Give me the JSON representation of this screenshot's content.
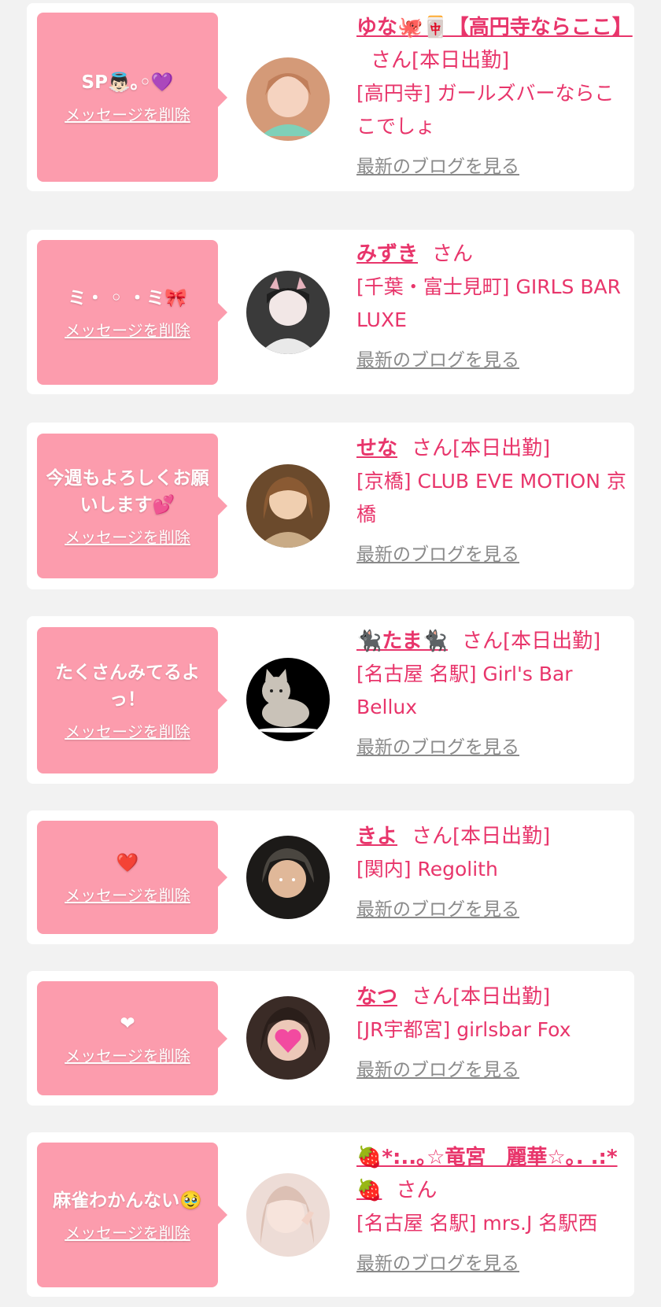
{
  "cards": [
    {
      "message": "SP👼🏻｡◦💜",
      "delete_label": "メッセージを削除",
      "name": "ゆな🐙🀄【高円寺ならここ】",
      "suffix": "さん[本日出勤]",
      "shop": "[高円寺] ガールズバーならここでしょ",
      "blog_label": "最新のブログを見る",
      "avatar_colors": [
        "#f2c7a8",
        "#d8a07a",
        "#7fd0b8"
      ]
    },
    {
      "message": "ミ・ ◦ ・ミ🎀",
      "delete_label": "メッセージを削除",
      "name": "みずき",
      "suffix": "さん",
      "shop": "[千葉・富士見町] GIRLS BAR LUXE",
      "blog_label": "最新のブログを見る",
      "avatar_colors": [
        "#2e2e2e",
        "#efe6e6",
        "#b5b5b5"
      ]
    },
    {
      "message": "今週もよろしくお願いします💕",
      "delete_label": "メッセージを削除",
      "name": "せな",
      "suffix": "さん[本日出勤]",
      "shop": "[京橋] CLUB EVE MOTION 京橋",
      "blog_label": "最新のブログを見る",
      "avatar_colors": [
        "#6b4a2c",
        "#e2c09a",
        "#c7a97f"
      ]
    },
    {
      "message": "たくさんみてるよっ！",
      "delete_label": "メッセージを削除",
      "name": "🐈‍⬛たま🐈‍⬛",
      "suffix": "さん[本日出勤]",
      "shop": "[名古屋 名駅] Girl's Bar Bellux",
      "blog_label": "最新のブログを見る",
      "avatar_colors": [
        "#000000",
        "#c9c2b8",
        "#9c9489"
      ]
    },
    {
      "message": "❤️",
      "delete_label": "メッセージを削除",
      "name": "きよ",
      "suffix": "さん[本日出勤]",
      "shop": "[関内] Regolith",
      "blog_label": "最新のブログを見る",
      "avatar_colors": [
        "#1c1a18",
        "#d9b398",
        "#5a5a50"
      ]
    },
    {
      "message": "❤",
      "delete_label": "メッセージを削除",
      "name": "なつ",
      "suffix": "さん[本日出勤]",
      "shop": "[JR宇都宮] girlsbar Fox",
      "blog_label": "最新のブログを見る",
      "avatar_colors": [
        "#3a2b26",
        "#e8c4b5",
        "#f24aa0"
      ]
    },
    {
      "message": "麻雀わかんない🥹",
      "delete_label": "メッセージを削除",
      "name": "🍓*:..｡☆竜宮　麗華☆｡. .:*🍓",
      "suffix": "さん",
      "shop": "[名古屋 名駅] mrs.J 名駅西",
      "blog_label": "最新のブログを見る",
      "avatar_colors": [
        "#e8cfc8",
        "#f3ddd4",
        "#c9a59a"
      ]
    }
  ]
}
